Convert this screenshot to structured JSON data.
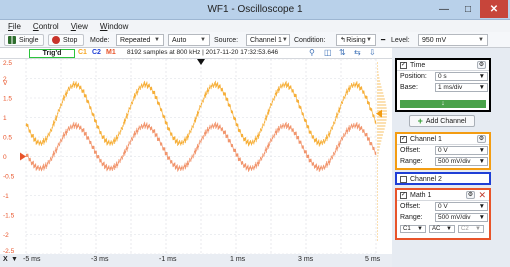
{
  "window": {
    "title": "WF1 - Oscilloscope 1"
  },
  "menu": [
    "File",
    "Control",
    "View",
    "Window"
  ],
  "toolbar": {
    "single_label": "Single",
    "stop_label": "Stop",
    "mode_label": "Mode:",
    "mode_value": "Repeated",
    "auto_value": "Auto",
    "source_label": "Source:",
    "source_value": "Channel 1",
    "condition_label": "Condition:",
    "condition_value": "Rising",
    "level_label": "Level:",
    "level_value": "950 mV"
  },
  "status": {
    "trigger_state": "Trig'd",
    "c1": "C1",
    "c2": "C2",
    "m1": "M1",
    "acq_info": "8192 samples at 800 kHz | 2017-11-20 17:32:53.646"
  },
  "plot": {
    "background": "#ffffff",
    "grid_color": "#d9dde3",
    "c1_color": "#f5a623",
    "m1_color": "#f08a5d",
    "y_ticks": [
      "2.5",
      "2",
      "1.5",
      "1",
      "0.5",
      "0",
      "-0.5",
      "-1",
      "-1.5",
      "-2",
      "-2.5"
    ],
    "y_unit": "V",
    "x_ticks": [
      "-5 ms",
      "-3 ms",
      "-1 ms",
      "1 ms",
      "3 ms",
      "5 ms"
    ],
    "x_axis_prefix": "X"
  },
  "chart_data": {
    "type": "line",
    "x_range": [
      -5,
      5
    ],
    "x_unit": "ms",
    "y_range": [
      -2.5,
      2.5
    ],
    "y_unit": "V",
    "grid": true,
    "series": [
      {
        "name": "C1",
        "color": "#f5a623",
        "offset": 1.1,
        "amplitude": 0.75,
        "frequency_khz": 0.5
      },
      {
        "name": "M1",
        "color": "#f08a5d",
        "offset": 0.25,
        "amplitude": 0.55,
        "frequency_khz": 0.5
      }
    ]
  },
  "sidebar": {
    "time": {
      "title": "Time",
      "position_label": "Position:",
      "position_value": "0 s",
      "base_label": "Base:",
      "base_value": "1 ms/div",
      "border_color": "#000000"
    },
    "add_channel_label": "Add Channel",
    "channel1": {
      "title": "Channel 1",
      "offset_label": "Offset:",
      "offset_value": "0 V",
      "range_label": "Range:",
      "range_value": "500 mV/div",
      "border_color": "#f39c12"
    },
    "channel2": {
      "title": "Channel 2",
      "border_color": "#1f3fd6"
    },
    "math1": {
      "title": "Math 1",
      "offset_label": "Offset:",
      "offset_value": "0 V",
      "range_label": "Range:",
      "range_value": "500 mV/div",
      "src1": "C1",
      "op": "AC",
      "src2": "C2",
      "border_color": "#e8542a"
    }
  }
}
